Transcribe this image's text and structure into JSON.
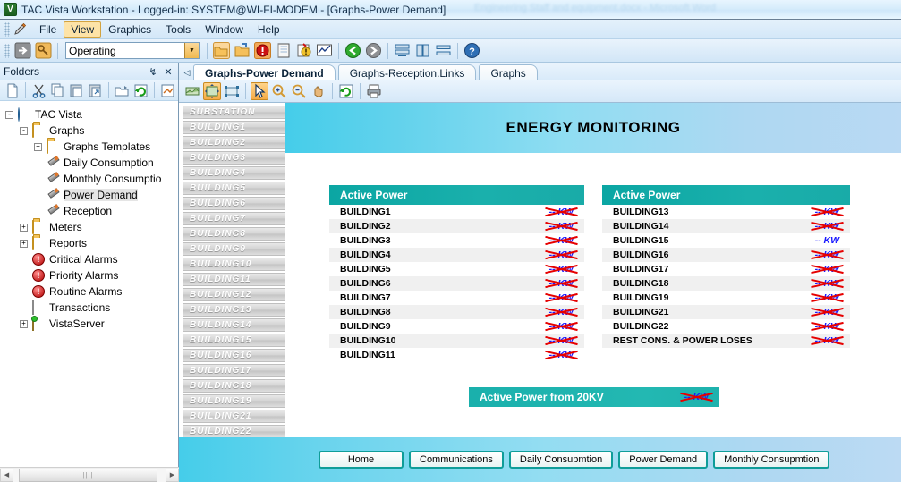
{
  "window": {
    "title": "TAC Vista Workstation - Logged-in: SYSTEM@WI-FI-MODEM - [Graphs-Power Demand]",
    "background_window_title": "Engineering Staff and equipment.docx  -  Microsoft Word",
    "app_icon": "tac-vista-icon"
  },
  "menu": {
    "items": [
      {
        "label": "File",
        "active": false
      },
      {
        "label": "View",
        "active": true
      },
      {
        "label": "Graphics",
        "active": false
      },
      {
        "label": "Tools",
        "active": false
      },
      {
        "label": "Window",
        "active": false
      },
      {
        "label": "Help",
        "active": false
      }
    ]
  },
  "toolbar": {
    "mode_select_value": "Operating",
    "icons": [
      "arrow-right-icon",
      "key-icon",
      "open-folder-icon",
      "new-folder-icon",
      "alarm-icon",
      "log-icon",
      "event-icon",
      "trend-icon",
      "back-icon",
      "forward-icon",
      "tile-horizontal-icon",
      "tile-vertical-icon",
      "cascade-icon",
      "help-icon"
    ]
  },
  "folders_panel": {
    "title": "Folders",
    "pin_label": "↯",
    "close_label": "✕",
    "toolbar_icons": [
      "new-icon",
      "cut-icon",
      "copy-icon",
      "paste-icon",
      "paste-shortcut-icon",
      "open-icon",
      "refresh-icon",
      "properties-icon"
    ],
    "tree": [
      {
        "label": "TAC Vista",
        "icon": "globe-icon",
        "depth": 0,
        "expander": "-",
        "selected": false
      },
      {
        "label": "Graphs",
        "icon": "folder-icon",
        "depth": 1,
        "expander": "-",
        "selected": false
      },
      {
        "label": "Graphs Templates",
        "icon": "folder-icon",
        "depth": 2,
        "expander": "+",
        "selected": false
      },
      {
        "label": "Daily Consumption",
        "icon": "pen-icon",
        "depth": 2,
        "expander": "",
        "selected": false
      },
      {
        "label": "Monthly Consumptio",
        "icon": "pen-icon",
        "depth": 2,
        "expander": "",
        "selected": false
      },
      {
        "label": "Power Demand",
        "icon": "pen-icon",
        "depth": 2,
        "expander": "",
        "selected": true
      },
      {
        "label": "Reception",
        "icon": "pen-icon",
        "depth": 2,
        "expander": "",
        "selected": false
      },
      {
        "label": "Meters",
        "icon": "folder-icon",
        "depth": 1,
        "expander": "+",
        "selected": false
      },
      {
        "label": "Reports",
        "icon": "folder-icon",
        "depth": 1,
        "expander": "+",
        "selected": false
      },
      {
        "label": "Critical Alarms",
        "icon": "alarm-icon",
        "depth": 1,
        "expander": "",
        "selected": false
      },
      {
        "label": "Priority Alarms",
        "icon": "alarm-icon",
        "depth": 1,
        "expander": "",
        "selected": false
      },
      {
        "label": "Routine Alarms",
        "icon": "alarm-icon",
        "depth": 1,
        "expander": "",
        "selected": false
      },
      {
        "label": "Transactions",
        "icon": "document-icon",
        "depth": 1,
        "expander": "",
        "selected": false
      },
      {
        "label": "VistaServer",
        "icon": "server-icon",
        "depth": 0,
        "expander": "+",
        "selected": false
      }
    ]
  },
  "tabs": {
    "nav_prev": "◁",
    "items": [
      {
        "label": "Graphs-Power Demand",
        "active": true
      },
      {
        "label": "Graphs-Reception.Links",
        "active": false
      },
      {
        "label": "Graphs",
        "active": false
      }
    ]
  },
  "graphics_toolbar": {
    "icons": [
      "fit-width-icon",
      "fit-page-icon",
      "actual-size-icon",
      "select-arrow-icon",
      "zoom-in-icon",
      "zoom-out-icon",
      "pan-hand-icon",
      "refresh-icon",
      "print-icon"
    ]
  },
  "graphic": {
    "header_title": "ENERGY MONITORING",
    "side_buttons": [
      "SUBSTATION",
      "BUILDING1",
      "BUILDING2",
      "BUILDING3",
      "BUILDING4",
      "BUILDING5",
      "BUILDING6",
      "BUILDING7",
      "BUILDING8",
      "BUILDING9",
      "BUILDING10",
      "BUILDING11",
      "BUILDING12",
      "BUILDING13",
      "BUILDING14",
      "BUILDING15",
      "BUILDING16",
      "BUILDING17",
      "BUILDING18",
      "BUILDING19",
      "BUILDING21",
      "BUILDING22"
    ],
    "panel_left": {
      "header": "Active Power",
      "rows": [
        {
          "label": "BUILDING1",
          "value": "-- KW",
          "error": true
        },
        {
          "label": "BUILDING2",
          "value": "-- KW",
          "error": true
        },
        {
          "label": "BUILDING3",
          "value": "-- KW",
          "error": true
        },
        {
          "label": "BUILDING4",
          "value": "-- KW",
          "error": true
        },
        {
          "label": "BUILDING5",
          "value": "-- KW",
          "error": true
        },
        {
          "label": "BUILDING6",
          "value": "-- KW",
          "error": true
        },
        {
          "label": "BUILDING7",
          "value": "-- KW",
          "error": true
        },
        {
          "label": "BUILDING8",
          "value": "-- KW",
          "error": true
        },
        {
          "label": "BUILDING9",
          "value": "-- KW",
          "error": true
        },
        {
          "label": "BUILDING10",
          "value": "-- KW",
          "error": true
        },
        {
          "label": "BUILDING11",
          "value": "-- KW",
          "error": true
        }
      ]
    },
    "panel_right": {
      "header": "Active Power",
      "rows": [
        {
          "label": "BUILDING13",
          "value": "-- KW",
          "error": true
        },
        {
          "label": "BUILDING14",
          "value": "-- KW",
          "error": true
        },
        {
          "label": "BUILDING15",
          "value": "-- KW",
          "error": false
        },
        {
          "label": "BUILDING16",
          "value": "-- KW",
          "error": true
        },
        {
          "label": "BUILDING17",
          "value": "-- KW",
          "error": true
        },
        {
          "label": "BUILDING18",
          "value": "-- KW",
          "error": true
        },
        {
          "label": "BUILDING19",
          "value": "-- KW",
          "error": true
        },
        {
          "label": "BUILDING21",
          "value": "-- KW",
          "error": true
        },
        {
          "label": "BUILDING22",
          "value": "-- KW",
          "error": true
        },
        {
          "label": "REST CONS. &  POWER LOSES",
          "value": "-- KW",
          "error": true
        }
      ]
    },
    "total_bar": {
      "label": "Active Power from 20KV",
      "value": "-- KW",
      "error": true
    },
    "nav_buttons": [
      "Home",
      "Communications",
      "Daily Consupmtion",
      "Power Demand",
      "Monthly Consupmtion"
    ]
  },
  "scrollbar": {
    "left_arrow": "◀",
    "right_arrow": "▶",
    "grip": "||||"
  },
  "colors": {
    "accent_teal": "#16aca8",
    "header_cyan": "#45cdea",
    "value_blue": "#1a1aff",
    "error_red": "#e60000"
  }
}
